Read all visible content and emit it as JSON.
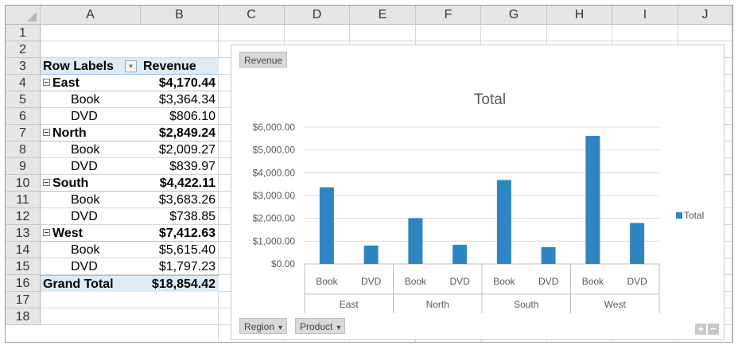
{
  "columns": [
    "A",
    "B",
    "C",
    "D",
    "E",
    "F",
    "G",
    "H",
    "I",
    "J"
  ],
  "rows": [
    "1",
    "2",
    "3",
    "4",
    "5",
    "6",
    "7",
    "8",
    "9",
    "10",
    "11",
    "12",
    "13",
    "14",
    "15",
    "16",
    "17",
    "18"
  ],
  "pivot": {
    "header_row_labels": "Row Labels",
    "header_revenue": "Revenue",
    "filter_icon": "dropdown-arrow-icon",
    "rows": [
      {
        "label": "East",
        "value": "$4,170.44",
        "level": "group"
      },
      {
        "label": "Book",
        "value": "$3,364.34",
        "level": "item"
      },
      {
        "label": "DVD",
        "value": "$806.10",
        "level": "item"
      },
      {
        "label": "North",
        "value": "$2,849.24",
        "level": "group"
      },
      {
        "label": "Book",
        "value": "$2,009.27",
        "level": "item"
      },
      {
        "label": "DVD",
        "value": "$839.97",
        "level": "item"
      },
      {
        "label": "South",
        "value": "$4,422.11",
        "level": "group"
      },
      {
        "label": "Book",
        "value": "$3,683.26",
        "level": "item"
      },
      {
        "label": "DVD",
        "value": "$738.85",
        "level": "item"
      },
      {
        "label": "West",
        "value": "$7,412.63",
        "level": "group"
      },
      {
        "label": "Book",
        "value": "$5,615.40",
        "level": "item"
      },
      {
        "label": "DVD",
        "value": "$1,797.23",
        "level": "item"
      }
    ],
    "grand_total_label": "Grand Total",
    "grand_total_value": "$18,854.42"
  },
  "chart_field_buttons": {
    "values_button": "Revenue",
    "axis_buttons": [
      {
        "label": "Region"
      },
      {
        "label": "Product"
      }
    ],
    "dropdown_glyph": "▾"
  },
  "chart_data": {
    "type": "bar",
    "title": "Total",
    "groups": [
      "East",
      "North",
      "South",
      "West"
    ],
    "categories": [
      "Book",
      "DVD",
      "Book",
      "DVD",
      "Book",
      "DVD",
      "Book",
      "DVD"
    ],
    "series": [
      {
        "name": "Total",
        "values": [
          3364.34,
          806.1,
          2009.27,
          839.97,
          3683.26,
          738.85,
          5615.4,
          1797.23
        ]
      }
    ],
    "ylim": [
      0,
      6000
    ],
    "y_ticks": [
      "$0.00",
      "$1,000.00",
      "$2,000.00",
      "$3,000.00",
      "$4,000.00",
      "$5,000.00",
      "$6,000.00"
    ],
    "grid": true,
    "legend": "right",
    "bar_color": "#2e86c1"
  },
  "chart_controls": {
    "plus": "+",
    "minus": "−"
  }
}
